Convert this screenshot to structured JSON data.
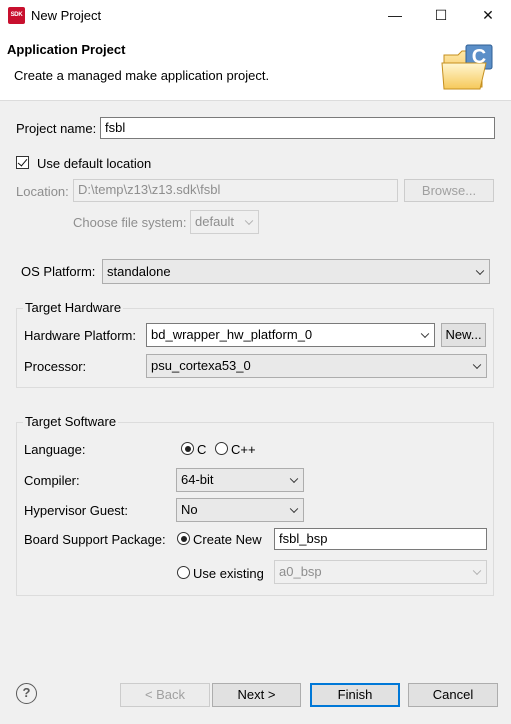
{
  "window": {
    "icon_text": "SDK",
    "title": "New Project",
    "minimize_glyph": "—",
    "maximize_glyph": "☐",
    "close_glyph": "✕"
  },
  "header": {
    "title": "Application Project",
    "description": "Create a managed make application project.",
    "icon": "folder-c-icon",
    "icon_letter": "C"
  },
  "project": {
    "name_label": "Project name:",
    "name_value": "fsbl",
    "use_default_label": "Use default location",
    "use_default_checked": true,
    "location_label": "Location:",
    "location_value": "D:\\temp\\z13\\z13.sdk\\fsbl",
    "browse_label": "Browse...",
    "filesystem_label": "Choose file system:",
    "filesystem_value": "default"
  },
  "os": {
    "label": "OS Platform:",
    "value": "standalone"
  },
  "target_hardware": {
    "title": "Target Hardware",
    "platform_label": "Hardware Platform:",
    "platform_value": "bd_wrapper_hw_platform_0",
    "new_label": "New...",
    "processor_label": "Processor:",
    "processor_value": "psu_cortexa53_0"
  },
  "target_software": {
    "title": "Target Software",
    "language_label": "Language:",
    "language_c": "C",
    "language_cpp": "C++",
    "language_selected": "C",
    "compiler_label": "Compiler:",
    "compiler_value": "64-bit",
    "hypervisor_label": "Hypervisor Guest:",
    "hypervisor_value": "No",
    "bsp_label": "Board Support Package:",
    "create_new_label": "Create New",
    "create_new_value": "fsbl_bsp",
    "use_existing_label": "Use existing",
    "use_existing_value": "a0_bsp",
    "bsp_selected": "Create New"
  },
  "footer": {
    "help_glyph": "?",
    "back_label": "< Back",
    "next_label": "Next >",
    "finish_label": "Finish",
    "cancel_label": "Cancel"
  },
  "colors": {
    "accent": "#0078d7",
    "sdk_red": "#c8102e"
  }
}
